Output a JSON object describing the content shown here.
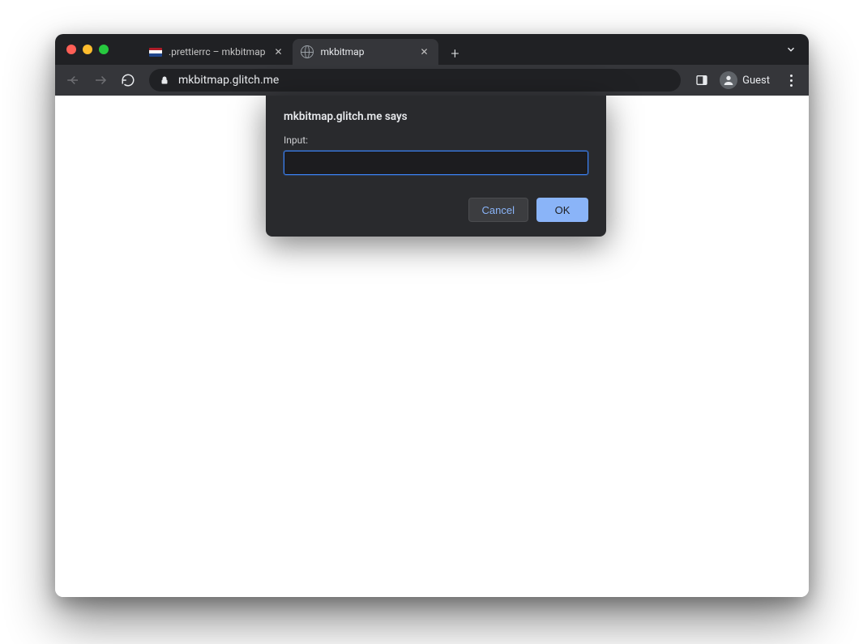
{
  "tabs": [
    {
      "label": ".prettierrc – mkbitmap",
      "active": false
    },
    {
      "label": "mkbitmap",
      "active": true
    }
  ],
  "addressbar": {
    "url": "mkbitmap.glitch.me"
  },
  "profile": {
    "label": "Guest"
  },
  "dialog": {
    "headline": "mkbitmap.glitch.me says",
    "prompt_label": "Input:",
    "input_value": "",
    "cancel_label": "Cancel",
    "ok_label": "OK"
  }
}
